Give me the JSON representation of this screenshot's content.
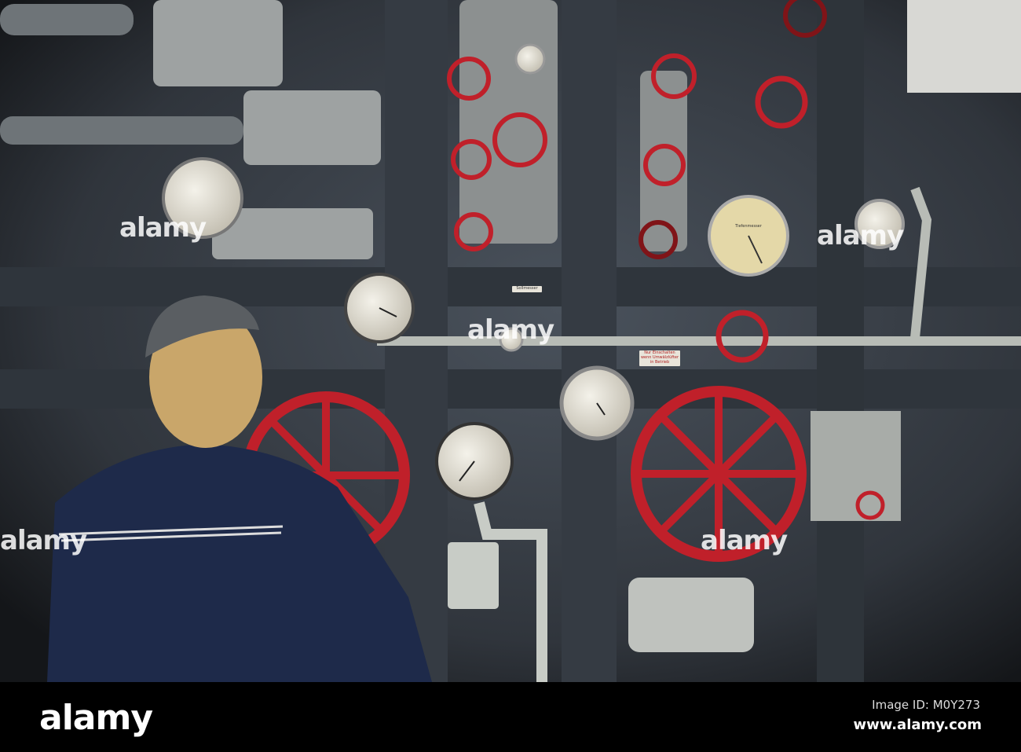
{
  "photo": {
    "subject": "submarine control panel with red valve wheels and gauges",
    "plates": {
      "left": "Sollmesser",
      "warning": "Nur Einschalten wenn Umwälzlüfter in Betrieb"
    },
    "gauge_labels": {
      "depth_gauge": "Tiefenmesser"
    }
  },
  "watermark": {
    "text": "alamy",
    "image_id": "Image ID: M0Y273",
    "url": "www.alamy.com"
  },
  "colors": {
    "panel": "#3a4048",
    "valve_red": "#c0202a",
    "uniform": "#1e2a4a",
    "pipe": "#b8bcb6"
  }
}
